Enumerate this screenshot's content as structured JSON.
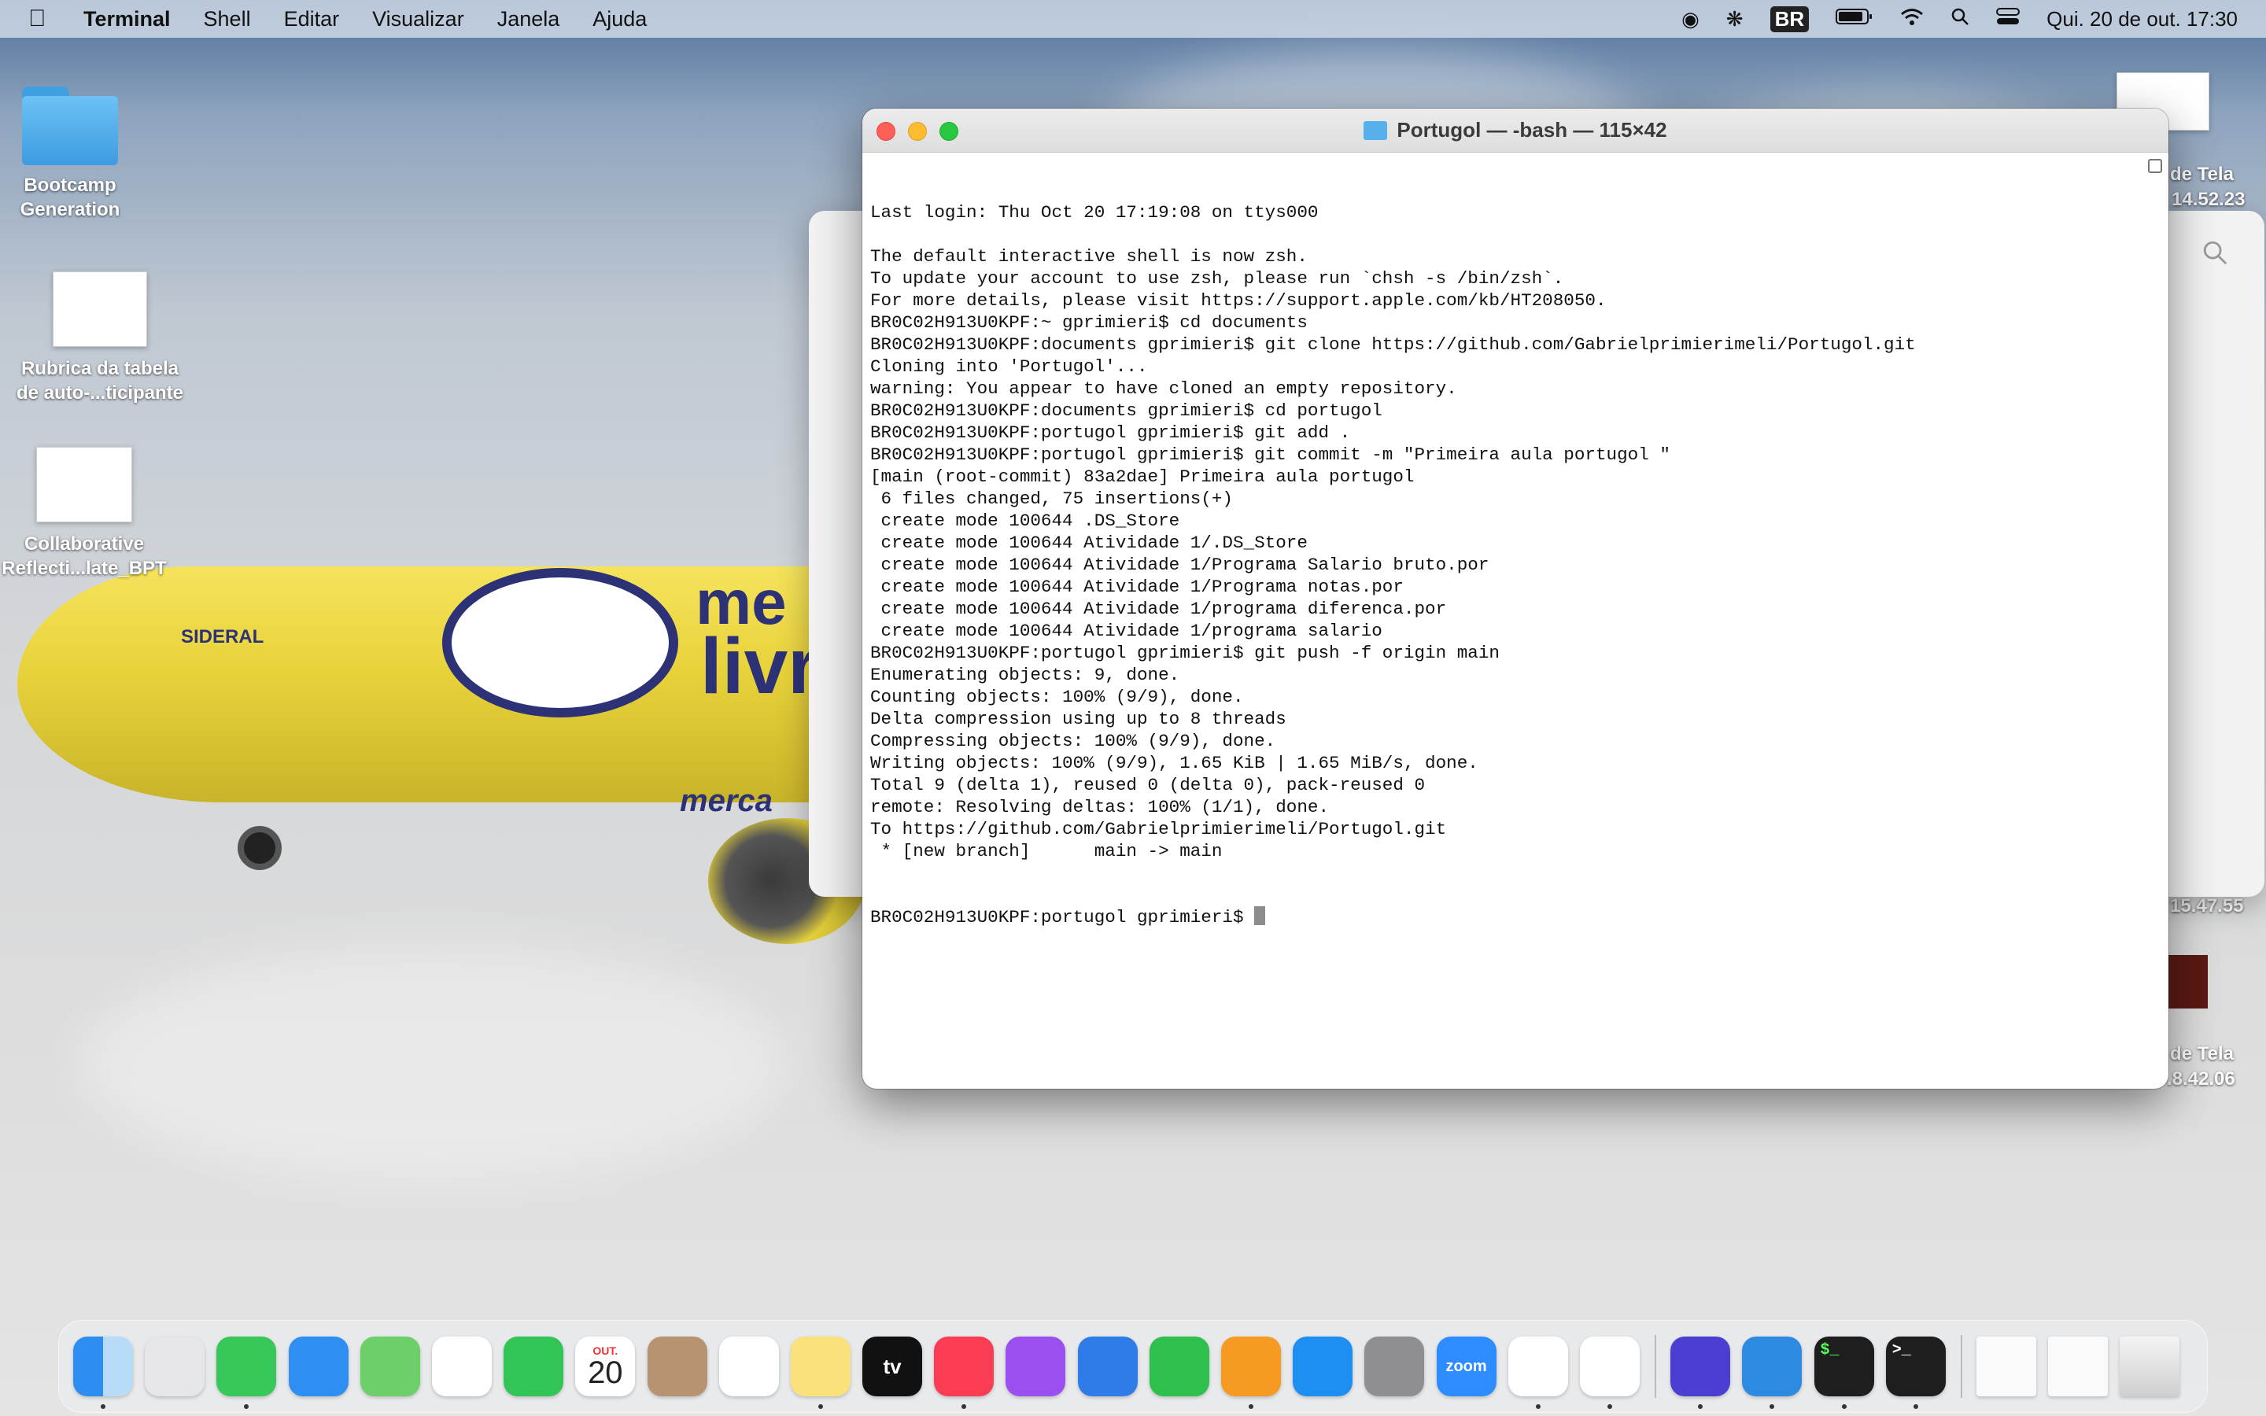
{
  "menubar": {
    "app_name": "Terminal",
    "menus": [
      "Shell",
      "Editar",
      "Visualizar",
      "Janela",
      "Ajuda"
    ],
    "status": {
      "input_source": "BR",
      "datetime": "Qui. 20 de out.  17:30"
    }
  },
  "desktop": {
    "items": [
      {
        "label_line1": "Bootcamp",
        "label_line2": "Generation"
      },
      {
        "label_line1": "Rubrica da tabela",
        "label_line2": "de auto-...ticipante"
      },
      {
        "label_line1": "Collaborative",
        "label_line2": "Reflecti...late_BPT"
      }
    ],
    "right_labels": [
      "de Tela",
      "14.52.23",
      "15.47.55",
      "de Tela",
      ".8.42.06"
    ]
  },
  "wallpaper": {
    "airline_text": "SIDERAL",
    "logo_text_1": "me",
    "logo_text_2": "livr",
    "logo_text_3": "merca"
  },
  "terminal": {
    "title": "Portugol — -bash — 115×42",
    "lines": [
      "Last login: Thu Oct 20 17:19:08 on ttys000",
      "",
      "The default interactive shell is now zsh.",
      "To update your account to use zsh, please run `chsh -s /bin/zsh`.",
      "For more details, please visit https://support.apple.com/kb/HT208050.",
      "BR0C02H913U0KPF:~ gprimieri$ cd documents",
      "BR0C02H913U0KPF:documents gprimieri$ git clone https://github.com/Gabrielprimierimeli/Portugol.git",
      "Cloning into 'Portugol'...",
      "warning: You appear to have cloned an empty repository.",
      "BR0C02H913U0KPF:documents gprimieri$ cd portugol",
      "BR0C02H913U0KPF:portugol gprimieri$ git add .",
      "BR0C02H913U0KPF:portugol gprimieri$ git commit -m \"Primeira aula portugol \"",
      "[main (root-commit) 83a2dae] Primeira aula portugol",
      " 6 files changed, 75 insertions(+)",
      " create mode 100644 .DS_Store",
      " create mode 100644 Atividade 1/.DS_Store",
      " create mode 100644 Atividade 1/Programa Salario bruto.por",
      " create mode 100644 Atividade 1/Programa notas.por",
      " create mode 100644 Atividade 1/programa diferenca.por",
      " create mode 100644 Atividade 1/programa salario",
      "BR0C02H913U0KPF:portugol gprimieri$ git push -f origin main",
      "Enumerating objects: 9, done.",
      "Counting objects: 100% (9/9), done.",
      "Delta compression using up to 8 threads",
      "Compressing objects: 100% (9/9), done.",
      "Writing objects: 100% (9/9), 1.65 KiB | 1.65 MiB/s, done.",
      "Total 9 (delta 1), reused 0 (delta 0), pack-reused 0",
      "remote: Resolving deltas: 100% (1/1), done.",
      "To https://github.com/Gabrielprimierimeli/Portugol.git",
      " * [new branch]      main -> main"
    ],
    "prompt": "BR0C02H913U0KPF:portugol gprimieri$ "
  },
  "dock": {
    "calendar_month": "OUT.",
    "calendar_day": "20",
    "tv_label": "tv",
    "zoom_label": "zoom",
    "apps": [
      {
        "name": "finder-icon",
        "color": "#2e8df0"
      },
      {
        "name": "launchpad-icon",
        "color": "#e6e6ea"
      },
      {
        "name": "messages-icon",
        "color": "#38c759"
      },
      {
        "name": "mail-icon",
        "color": "#2f8ef2"
      },
      {
        "name": "maps-icon",
        "color": "#6ccf6a"
      },
      {
        "name": "photos-icon",
        "color": "#ffffff"
      },
      {
        "name": "facetime-icon",
        "color": "#33c458"
      },
      {
        "name": "calendar-icon",
        "color": "#ffffff"
      },
      {
        "name": "contacts-icon",
        "color": "#b89372"
      },
      {
        "name": "reminders-icon",
        "color": "#ffffff"
      },
      {
        "name": "notes-icon",
        "color": "#fbe17b"
      },
      {
        "name": "appletv-icon",
        "color": "#111111"
      },
      {
        "name": "music-icon",
        "color": "#fa3c55"
      },
      {
        "name": "podcasts-icon",
        "color": "#9b4ff0"
      },
      {
        "name": "keynote-icon",
        "color": "#2f7bea"
      },
      {
        "name": "numbers-icon",
        "color": "#2fbf4d"
      },
      {
        "name": "pages-icon",
        "color": "#f59a23"
      },
      {
        "name": "appstore-icon",
        "color": "#1d8ff2"
      },
      {
        "name": "systemprefs-icon",
        "color": "#8e8e93"
      },
      {
        "name": "zoom-icon",
        "color": "#2d8cff"
      },
      {
        "name": "slack-icon",
        "color": "#ffffff"
      },
      {
        "name": "chrome-icon",
        "color": "#ffffff"
      }
    ],
    "recent": [
      {
        "name": "workplace-icon",
        "color": "#4a3fd1"
      },
      {
        "name": "vscode-icon",
        "color": "#2d8ae0"
      },
      {
        "name": "terminal-green-icon",
        "color": "#1e1e1e"
      },
      {
        "name": "terminal-icon",
        "color": "#1e1e1e"
      }
    ],
    "terminal_glyph_1": "$_",
    "terminal_glyph_2": ">_"
  }
}
